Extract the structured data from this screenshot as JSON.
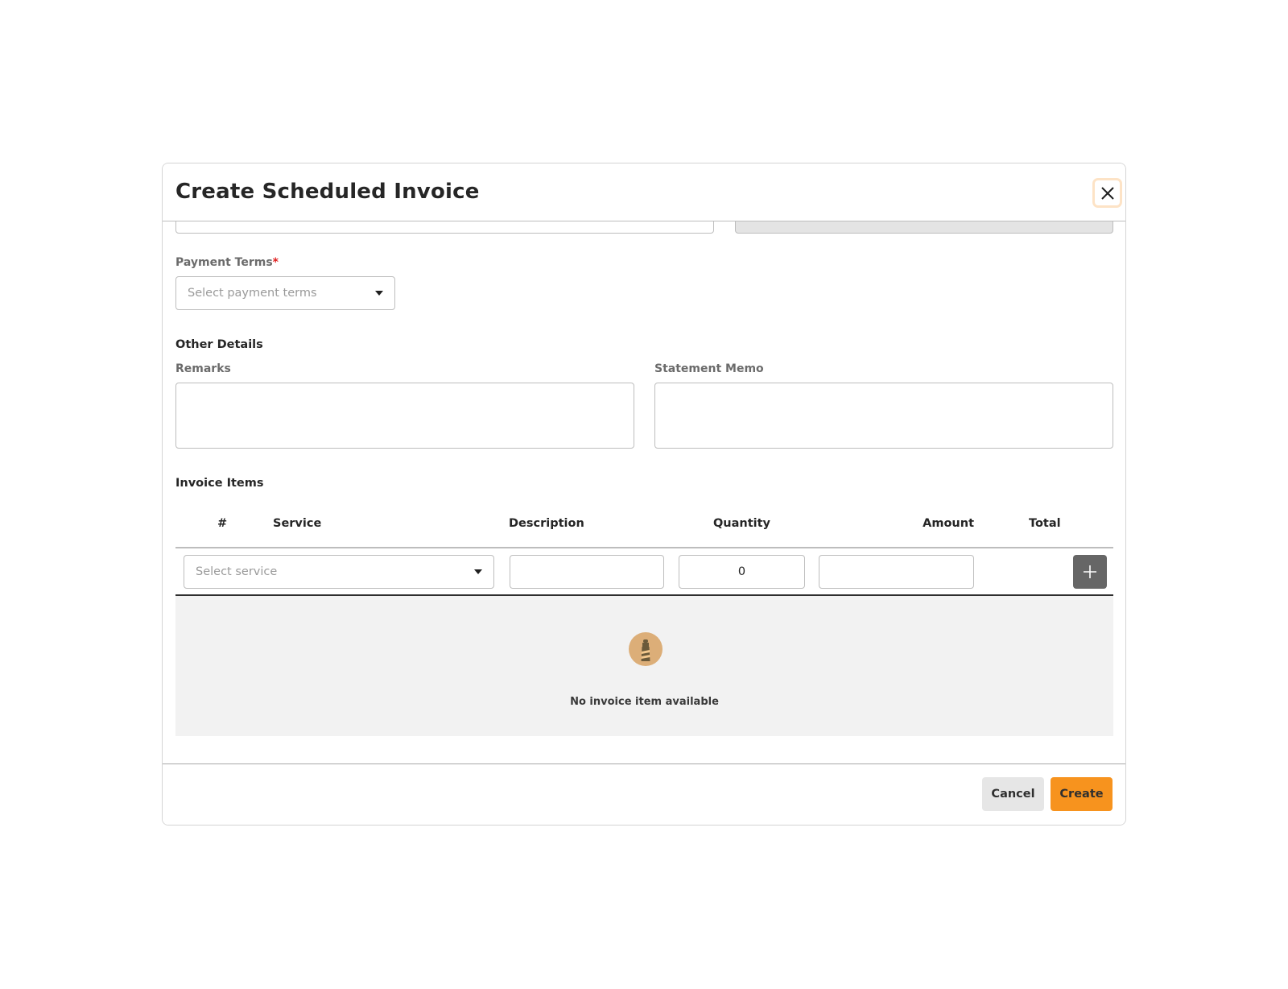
{
  "modal": {
    "title": "Create Scheduled Invoice",
    "close_icon": "close-icon"
  },
  "payment_terms": {
    "label": "Payment Terms",
    "required_marker": "*",
    "placeholder": "Select payment terms"
  },
  "other_details": {
    "title": "Other Details",
    "remarks_label": "Remarks",
    "remarks_value": "",
    "statement_memo_label": "Statement Memo",
    "statement_memo_value": ""
  },
  "invoice_items": {
    "title": "Invoice Items",
    "columns": [
      "#",
      "Service",
      "Description",
      "Quantity",
      "Amount",
      "Total"
    ],
    "new_row": {
      "service_placeholder": "Select service",
      "description": "",
      "quantity": "0",
      "amount": ""
    },
    "add_icon": "plus-icon",
    "empty_icon": "lighthouse-icon",
    "empty_text": "No invoice item available"
  },
  "footer": {
    "cancel_label": "Cancel",
    "create_label": "Create"
  },
  "colors": {
    "accent": "#f7931e",
    "close_focus_ring": "#fde3c6",
    "add_button": "#666666",
    "empty_bg": "#f2f2f2",
    "required": "#e02020"
  }
}
